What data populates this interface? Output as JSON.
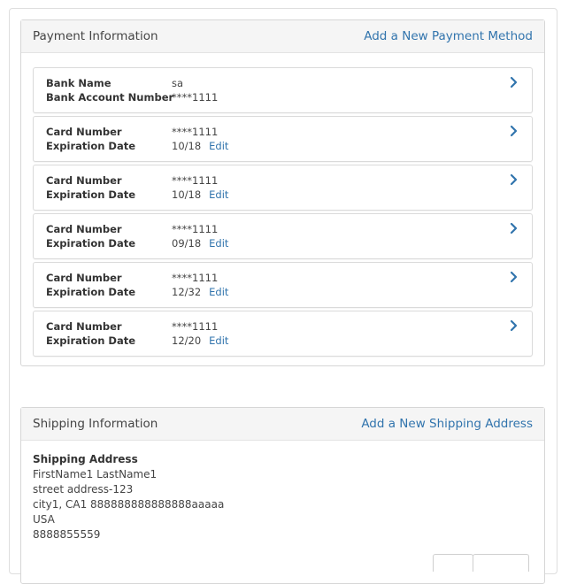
{
  "payment": {
    "title": "Payment Information",
    "add_link": "Add a New Payment Method",
    "items": [
      {
        "label1": "Bank Name",
        "value1": "sa",
        "label2": "Bank Account Number",
        "value2": "****1111",
        "edit": ""
      },
      {
        "label1": "Card Number",
        "value1": "****1111",
        "label2": "Expiration Date",
        "value2": "10/18",
        "edit": "Edit"
      },
      {
        "label1": "Card Number",
        "value1": "****1111",
        "label2": "Expiration Date",
        "value2": "10/18",
        "edit": "Edit"
      },
      {
        "label1": "Card Number",
        "value1": "****1111",
        "label2": "Expiration Date",
        "value2": "09/18",
        "edit": "Edit"
      },
      {
        "label1": "Card Number",
        "value1": "****1111",
        "label2": "Expiration Date",
        "value2": "12/32",
        "edit": "Edit"
      },
      {
        "label1": "Card Number",
        "value1": "****1111",
        "label2": "Expiration Date",
        "value2": "12/20",
        "edit": "Edit"
      }
    ]
  },
  "shipping": {
    "title": "Shipping Information",
    "add_link": "Add a New Shipping Address",
    "address_title": "Shipping Address",
    "name": "FirstName1 LastName1",
    "street": "street address-123",
    "city_line": "city1, CA1 888888888888888aaaaa",
    "country": "USA",
    "phone": "8888855559"
  },
  "colors": {
    "link": "#3174ad",
    "header_bg": "#f5f5f5",
    "border": "#d6d6d6"
  },
  "icons": {
    "row_action": "chevron-right-icon"
  }
}
